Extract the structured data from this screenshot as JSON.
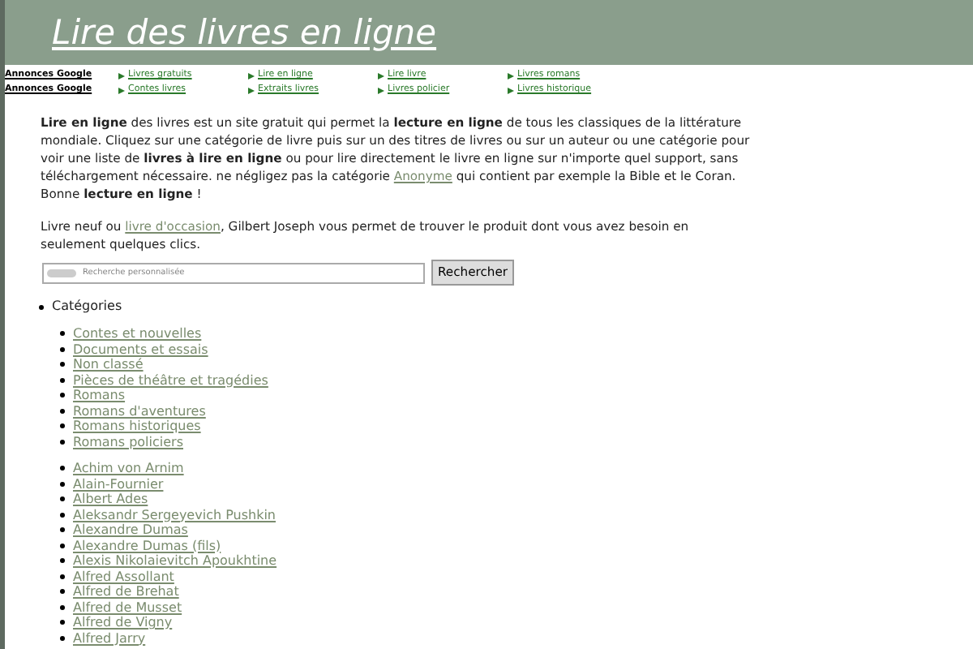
{
  "header": {
    "title": "Lire des livres en ligne"
  },
  "ad_rows": [
    {
      "label": "Annonces Google",
      "links": [
        "Livres gratuits",
        "Lire en ligne",
        "Lire livre",
        "Livres romans"
      ]
    },
    {
      "label": "Annonces Google",
      "links": [
        "Contes livres",
        "Extraits livres",
        "Livres policier",
        "Livres historique"
      ]
    }
  ],
  "paragraphs": [
    [
      {
        "text": "**Lire en ligne** des livres est un site gratuit qui permet la **lecture en ligne** de tous les classiques de la littérature mondiale. Cliquez sur une catégorie de livre puis sur un des titres de livres ou sur un auteur ou une catégorie pour voir une liste de **livres à lire en ligne** ou pour lire directement le livre en ligne sur n'importe quel support, sans téléchargement nécessaire. ne négligez pas la catégorie "
      },
      {
        "link": "Anonyme"
      },
      {
        "text": " qui contient par exemple la Bible et le Coran. Bonne **lecture en ligne** !"
      }
    ],
    [
      {
        "text": "Livre neuf ou "
      },
      {
        "link": "livre d'occasion"
      },
      {
        "text": ", Gilbert Joseph vous permet de trouver le produit dont vous avez besoin en seulement quelques clics."
      }
    ]
  ],
  "search": {
    "placeholder": "Recherche personnalisée",
    "button": "Rechercher"
  },
  "categories": {
    "heading": "Catégories",
    "items": [
      "Contes et nouvelles",
      "Documents et essais",
      "Non classé",
      "Pièces de théâtre et tragédies",
      "Romans",
      "Romans d'aventures",
      "Romans historiques",
      "Romans policiers"
    ]
  },
  "authors": [
    "Achim von Arnim",
    "Alain-Fournier",
    "Albert Ades",
    "Aleksandr Sergeyevich Pushkin",
    "Alexandre Dumas",
    "Alexandre Dumas (fils)",
    "Alexis Nikolaievitch Apoukhtine",
    "Alfred Assollant",
    "Alfred de Brehat",
    "Alfred de Musset",
    "Alfred de Vigny",
    "Alfred Jarry"
  ]
}
